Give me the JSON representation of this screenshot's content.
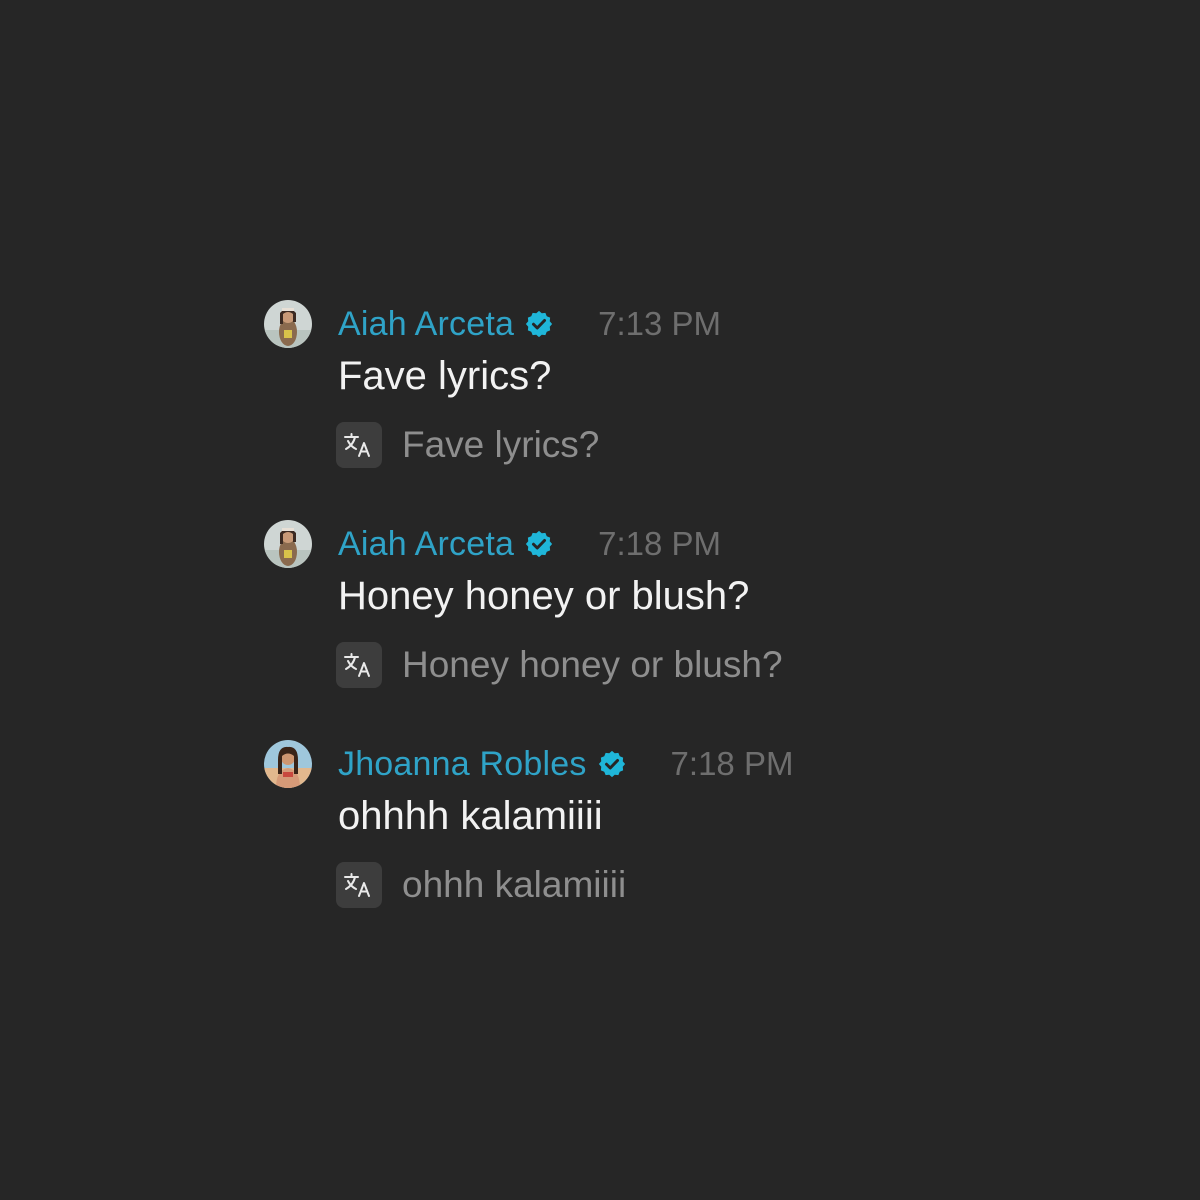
{
  "colors": {
    "background": "#262626",
    "name": "#2fa3c7",
    "verified_badge": "#1fb6d9",
    "timestamp": "#6e6e6e",
    "message_text": "#f2f2f2",
    "translation_text": "#8e8e8e",
    "translate_icon_bg": "#3d3d3d"
  },
  "messages": [
    {
      "author": "Aiah Arceta",
      "verified": true,
      "time": "7:13 PM",
      "text": "Fave lyrics?",
      "translation": "Fave lyrics?",
      "icons": {
        "avatar": "avatar-image",
        "badge": "verified-badge-icon",
        "translate": "translate-icon"
      }
    },
    {
      "author": "Aiah Arceta",
      "verified": true,
      "time": "7:18 PM",
      "text": "Honey honey or blush?",
      "translation": "Honey honey or blush?",
      "icons": {
        "avatar": "avatar-image",
        "badge": "verified-badge-icon",
        "translate": "translate-icon"
      }
    },
    {
      "author": "Jhoanna Robles",
      "verified": true,
      "time": "7:18 PM",
      "text": "ohhhh kalamiiii",
      "translation": "ohhh kalamiiii",
      "icons": {
        "avatar": "avatar-image",
        "badge": "verified-badge-icon",
        "translate": "translate-icon"
      }
    }
  ]
}
